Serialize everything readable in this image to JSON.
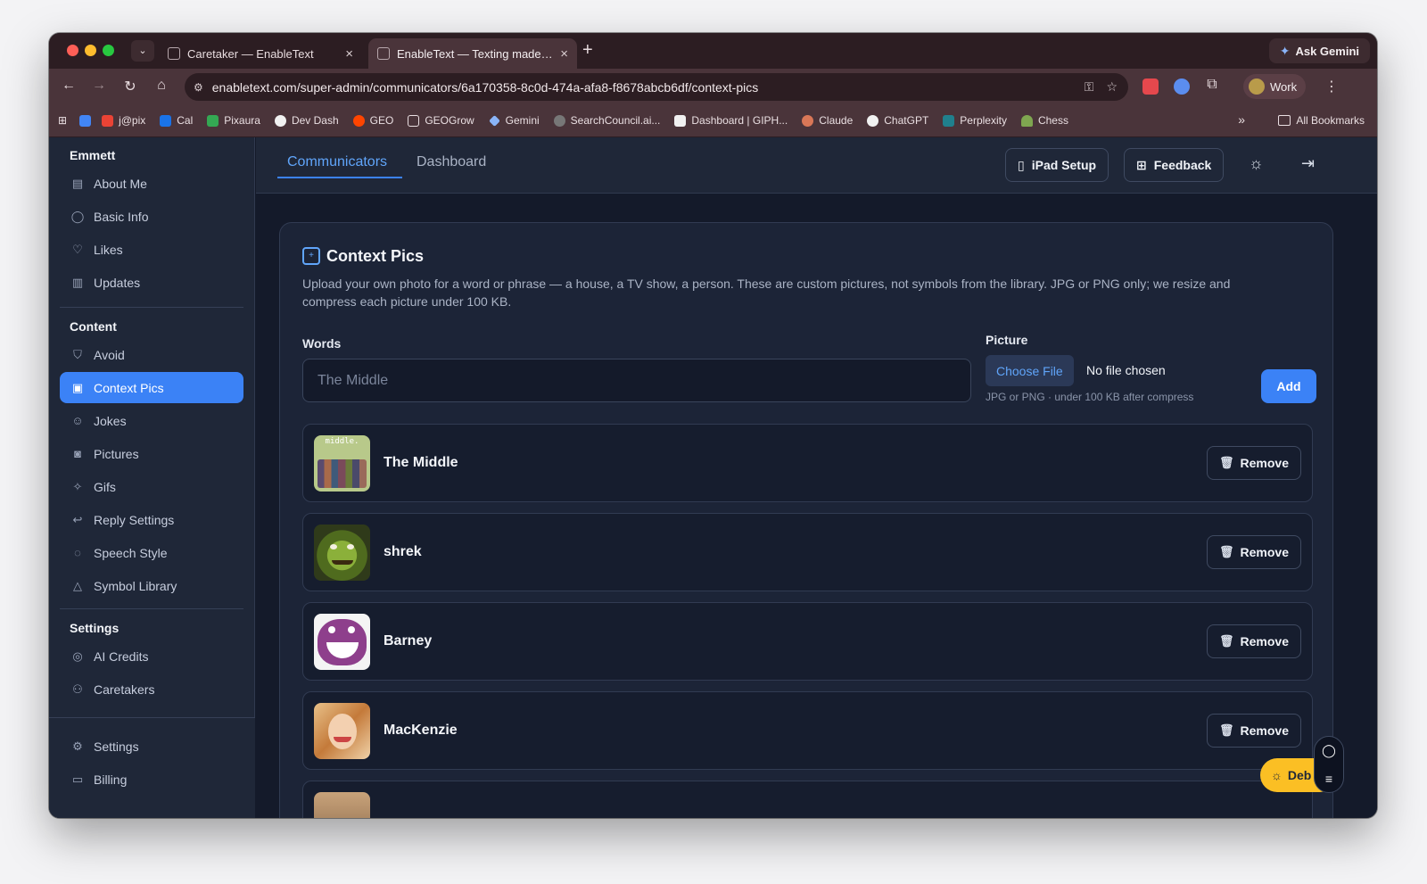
{
  "browser": {
    "tabs": [
      {
        "title": "Caretaker — EnableText",
        "active": false
      },
      {
        "title": "EnableText — Texting made easy",
        "active": true
      }
    ],
    "ask_gemini": "Ask Gemini",
    "url": "enabletext.com/super-admin/communicators/6a170358-8c0d-474a-afa8-f8678abcb6df/context-pics",
    "profile": "Work",
    "bookmarks": [
      "j@pix",
      "Cal",
      "Pixaura",
      "Dev Dash",
      "GEO",
      "GEOGrow",
      "Gemini",
      "SearchCouncil.ai...",
      "Dashboard | GIPH...",
      "Claude",
      "ChatGPT",
      "Perplexity",
      "Chess"
    ],
    "all_bookmarks": "All Bookmarks"
  },
  "sidebar": {
    "user_name": "Emmett",
    "profile_items": [
      {
        "label": "About Me",
        "icon": "id-card-icon"
      },
      {
        "label": "Basic Info",
        "icon": "user-icon"
      },
      {
        "label": "Likes",
        "icon": "heart-icon"
      },
      {
        "label": "Updates",
        "icon": "document-icon"
      }
    ],
    "content_heading": "Content",
    "content_items": [
      {
        "label": "Avoid",
        "icon": "shield-icon"
      },
      {
        "label": "Context Pics",
        "icon": "image-plus-icon",
        "active": true
      },
      {
        "label": "Jokes",
        "icon": "smile-icon"
      },
      {
        "label": "Pictures",
        "icon": "camera-icon"
      },
      {
        "label": "Gifs",
        "icon": "sparkles-icon"
      },
      {
        "label": "Reply Settings",
        "icon": "reply-icon"
      },
      {
        "label": "Speech Style",
        "icon": "chat-bubble-icon"
      },
      {
        "label": "Symbol Library",
        "icon": "shapes-icon"
      }
    ],
    "settings_heading": "Settings",
    "settings_items": [
      {
        "label": "AI Credits",
        "icon": "coins-icon"
      },
      {
        "label": "Caretakers",
        "icon": "users-icon"
      }
    ],
    "bottom_items": [
      {
        "label": "Settings",
        "icon": "gear-icon"
      },
      {
        "label": "Billing",
        "icon": "credit-card-icon"
      }
    ]
  },
  "topnav": {
    "tabs": [
      {
        "label": "Communicators",
        "active": true
      },
      {
        "label": "Dashboard",
        "active": false
      }
    ],
    "ipad_setup": "iPad Setup",
    "feedback": "Feedback"
  },
  "card": {
    "title": "Context Pics",
    "description": "Upload your own photo for a word or phrase — a house, a TV show, a person. These are custom pictures, not symbols from the library. JPG or PNG only; we resize and compress each picture under 100 KB.",
    "words_label": "Words",
    "words_placeholder": "The Middle",
    "picture_label": "Picture",
    "choose_file": "Choose File",
    "no_file": "No file chosen",
    "file_hint": "JPG or PNG · under 100 KB after compress",
    "add_button": "Add",
    "remove_label": "Remove",
    "items": [
      {
        "name": "The Middle",
        "thumb_color": "#b8c98a",
        "thumb_text": "middle."
      },
      {
        "name": "shrek",
        "thumb_color": "#6f8f2f"
      },
      {
        "name": "Barney",
        "thumb_color": "#8e3f8c"
      },
      {
        "name": "MacKenzie",
        "thumb_color": "#d49a52"
      }
    ]
  },
  "debug_button": "Deb"
}
